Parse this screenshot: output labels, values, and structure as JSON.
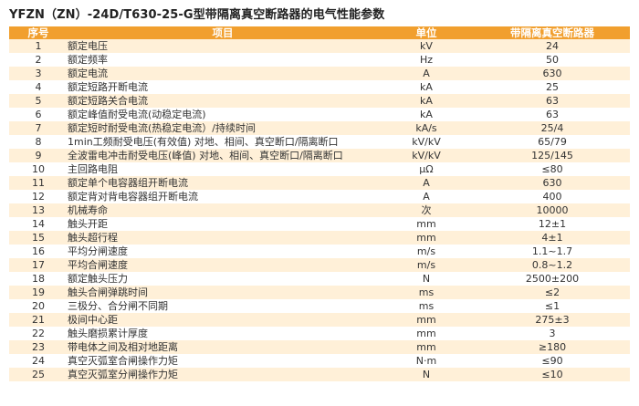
{
  "title": "YFZN（ZN）-24D/T630-25-G型带隔离真空断路器的电气性能参数",
  "headers": {
    "no": "序号",
    "item": "项目",
    "unit": "单位",
    "value": "带隔离真空断路器"
  },
  "rows": [
    {
      "no": "1",
      "item": "额定电压",
      "unit": "kV",
      "value": "24"
    },
    {
      "no": "2",
      "item": "额定频率",
      "unit": "Hz",
      "value": "50"
    },
    {
      "no": "3",
      "item": "额定电流",
      "unit": "A",
      "value": "630"
    },
    {
      "no": "4",
      "item": "额定短路开断电流",
      "unit": "kA",
      "value": "25"
    },
    {
      "no": "5",
      "item": "额定短路关合电流",
      "unit": "kA",
      "value": "63"
    },
    {
      "no": "6",
      "item": "额定峰值耐受电流(动稳定电流)",
      "unit": "kA",
      "value": "63"
    },
    {
      "no": "7",
      "item": "额定短时耐受电流(热稳定电流）/持续时间",
      "unit": "kA/s",
      "value": "25/4"
    },
    {
      "no": "8",
      "item": "1min工频耐受电压(有效值) 对地、相间、真空断口/隔离断口",
      "unit": "kV/kV",
      "value": "65/79"
    },
    {
      "no": "9",
      "item": "全波雷电冲击耐受电压(峰值) 对地、相间、真空断口/隔离断口",
      "unit": "kV/kV",
      "value": "125/145"
    },
    {
      "no": "10",
      "item": "主回路电阻",
      "unit": "μΩ",
      "value": "≤80"
    },
    {
      "no": "11",
      "item": "额定单个电容器组开断电流",
      "unit": "A",
      "value": "630"
    },
    {
      "no": "12",
      "item": "额定背对背电容器组开断电流",
      "unit": "A",
      "value": "400"
    },
    {
      "no": "13",
      "item": "机械寿命",
      "unit": "次",
      "value": "10000"
    },
    {
      "no": "14",
      "item": "触头开距",
      "unit": "mm",
      "value": "12±1"
    },
    {
      "no": "15",
      "item": "触头超行程",
      "unit": "mm",
      "value": "4±1"
    },
    {
      "no": "16",
      "item": "平均分闸速度",
      "unit": "m/s",
      "value": "1.1~1.7"
    },
    {
      "no": "17",
      "item": "平均合闸速度",
      "unit": "m/s",
      "value": "0.8~1.2"
    },
    {
      "no": "18",
      "item": "额定触头压力",
      "unit": "N",
      "value": "2500±200"
    },
    {
      "no": "19",
      "item": "触头合闸弹跳时间",
      "unit": "ms",
      "value": "≤2"
    },
    {
      "no": "20",
      "item": "三极分、合分闸不同期",
      "unit": "ms",
      "value": "≤1"
    },
    {
      "no": "21",
      "item": "极间中心距",
      "unit": "mm",
      "value": "275±3"
    },
    {
      "no": "22",
      "item": "触头磨损累计厚度",
      "unit": "mm",
      "value": "3"
    },
    {
      "no": "23",
      "item": "带电体之间及相对地距离",
      "unit": "mm",
      "value": "≥180"
    },
    {
      "no": "24",
      "item": "真空灭弧室合闸操作力矩",
      "unit": "N·m",
      "value": "≤90"
    },
    {
      "no": "25",
      "item": "真空灭弧室分闸操作力矩",
      "unit": "N",
      "value": "≤10"
    }
  ],
  "colors": {
    "header_bg": "#f19f2e",
    "stripe_bg": "#fff0d8"
  }
}
